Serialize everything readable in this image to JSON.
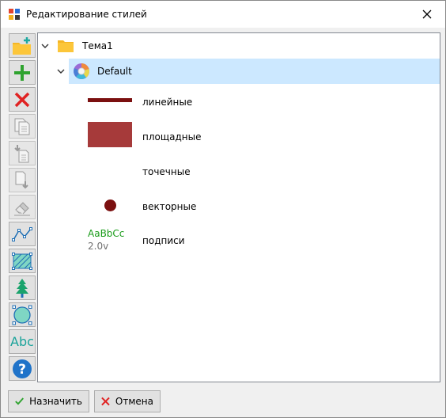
{
  "window": {
    "title": "Редактирование стилей"
  },
  "toolbar": {
    "buttons": [
      {
        "name": "new-folder-button",
        "icon": "folder-plus-icon",
        "enabled": true
      },
      {
        "name": "add-button",
        "icon": "plus-icon",
        "enabled": true
      },
      {
        "name": "delete-button",
        "icon": "red-x-icon",
        "enabled": true
      },
      {
        "name": "copy-button",
        "icon": "copy-icon",
        "enabled": false
      },
      {
        "name": "paste-button",
        "icon": "paste-icon",
        "enabled": false
      },
      {
        "name": "move-down-button",
        "icon": "document-down-icon",
        "enabled": false
      },
      {
        "name": "eraser-button",
        "icon": "eraser-icon",
        "enabled": false
      },
      {
        "name": "line-style-button",
        "icon": "polyline-icon",
        "enabled": true
      },
      {
        "name": "area-style-button",
        "icon": "hatched-area-icon",
        "enabled": true
      },
      {
        "name": "point-style-button",
        "icon": "tree-symbol-icon",
        "enabled": true
      },
      {
        "name": "vector-style-button",
        "icon": "circle-nodes-icon",
        "enabled": true
      },
      {
        "name": "label-style-button",
        "icon": "abc-text-icon",
        "enabled": true,
        "label": "Abc"
      },
      {
        "name": "help-button",
        "icon": "question-icon",
        "enabled": true
      }
    ]
  },
  "tree": {
    "root": {
      "label": "Тема1",
      "icon": "folder-icon",
      "expanded": true
    },
    "child": {
      "label": "Default",
      "icon": "color-wheel-icon",
      "expanded": true,
      "selected": true
    },
    "styles": [
      {
        "name": "линейные",
        "preview": "line"
      },
      {
        "name": "площадные",
        "preview": "area"
      },
      {
        "name": "точечные",
        "preview": "none"
      },
      {
        "name": "векторные",
        "preview": "dot"
      },
      {
        "name": "подписи",
        "preview": "text",
        "preview_text": "AaBbCc",
        "preview_sub": "2.0v"
      }
    ]
  },
  "colors": {
    "style_red": "#7b1010",
    "area_fill": "#a63a3a",
    "label_green": "#1a9c1a",
    "selection": "#cce8ff"
  },
  "footer": {
    "ok_label": "Назначить",
    "cancel_label": "Отмена"
  }
}
